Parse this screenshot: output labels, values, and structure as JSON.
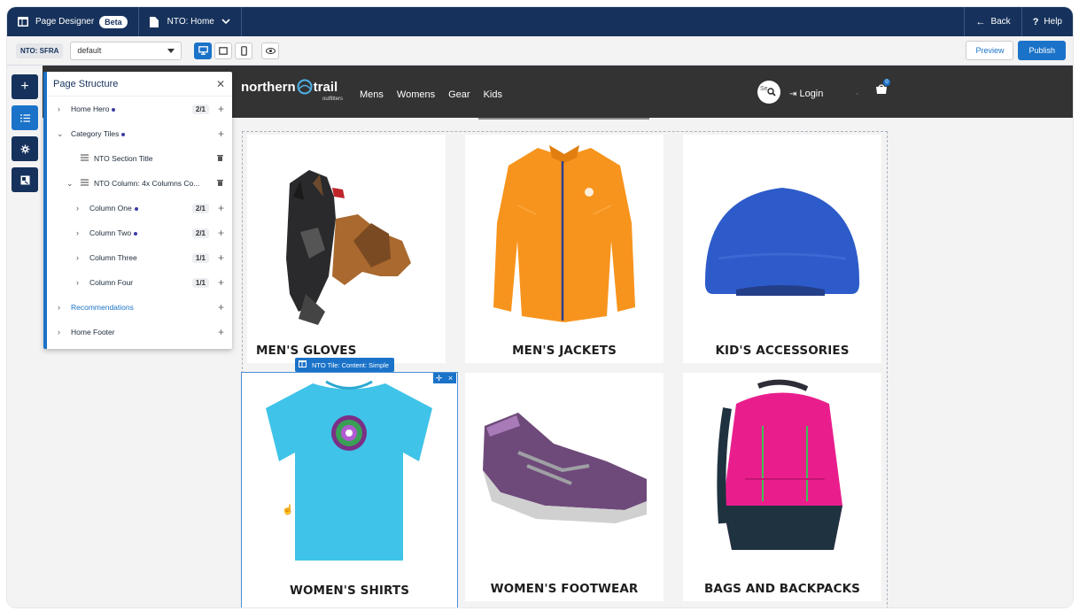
{
  "topbar": {
    "app_title": "Page Designer",
    "beta_badge": "Beta",
    "page_selector": "NTO: Home",
    "back_label": "Back",
    "help_label": "Help"
  },
  "toolbar": {
    "site_label": "NTO: SFRA",
    "locale_value": "default",
    "preview_label": "Preview",
    "publish_label": "Publish"
  },
  "site": {
    "logo_main": "northern",
    "logo_trail": "trail",
    "logo_sub": "outfitters",
    "nav": [
      "Mens",
      "Womens",
      "Gear",
      "Kids"
    ],
    "search_text": "Se",
    "login_label": "Login",
    "cart_count": "0"
  },
  "panel": {
    "title": "Page Structure",
    "rows": [
      {
        "label": "Home Hero",
        "count": "2/1"
      },
      {
        "label": "Category Tiles",
        "count": ""
      },
      {
        "label": "NTO Section Title",
        "count": ""
      },
      {
        "label": "NTO Column: 4x Columns Co...",
        "count": ""
      },
      {
        "label": "Column One",
        "count": "2/1"
      },
      {
        "label": "Column Two",
        "count": "2/1"
      },
      {
        "label": "Column Three",
        "count": "1/1"
      },
      {
        "label": "Column Four",
        "count": "1/1"
      },
      {
        "label": "Recommendations",
        "count": ""
      },
      {
        "label": "Home Footer",
        "count": ""
      }
    ]
  },
  "tiles": [
    {
      "title": "MEN'S GLOVES"
    },
    {
      "title": "MEN'S JACKETS"
    },
    {
      "title": "KID'S ACCESSORIES"
    },
    {
      "title": "WOMEN'S SHIRTS"
    },
    {
      "title": "WOMEN'S FOOTWEAR"
    },
    {
      "title": "BAGS AND BACKPACKS"
    }
  ],
  "selected_tile_tag": "NTO Tile: Content: Simple",
  "colors": {
    "header_navy": "#16325c",
    "accent_blue": "#1b73c9",
    "site_header": "#333333"
  }
}
